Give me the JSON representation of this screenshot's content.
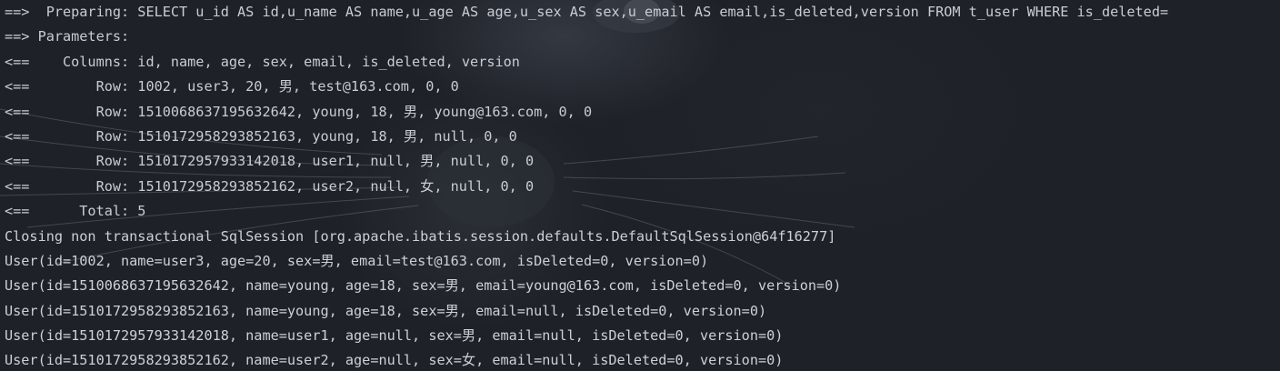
{
  "console": {
    "lines": [
      "==>  Preparing: SELECT u_id AS id,u_name AS name,u_age AS age,u_sex AS sex,u_email AS email,is_deleted,version FROM t_user WHERE is_deleted=",
      "==> Parameters: ",
      "<==    Columns: id, name, age, sex, email, is_deleted, version",
      "<==        Row: 1002, user3, 20, 男, test@163.com, 0, 0",
      "<==        Row: 1510068637195632642, young, 18, 男, young@163.com, 0, 0",
      "<==        Row: 1510172958293852163, young, 18, 男, null, 0, 0",
      "<==        Row: 1510172957933142018, user1, null, 男, null, 0, 0",
      "<==        Row: 1510172958293852162, user2, null, 女, null, 0, 0",
      "<==      Total: 5",
      "Closing non transactional SqlSession [org.apache.ibatis.session.defaults.DefaultSqlSession@64f16277]",
      "User(id=1002, name=user3, age=20, sex=男, email=test@163.com, isDeleted=0, version=0)",
      "User(id=1510068637195632642, name=young, age=18, sex=男, email=young@163.com, isDeleted=0, version=0)",
      "User(id=1510172958293852163, name=young, age=18, sex=男, email=null, isDeleted=0, version=0)",
      "User(id=1510172957933142018, name=user1, age=null, sex=男, email=null, isDeleted=0, version=0)",
      "User(id=1510172958293852162, name=user2, age=null, sex=女, email=null, isDeleted=0, version=0)"
    ]
  },
  "colors": {
    "background": "#1e2127",
    "text": "#c9cdd3"
  }
}
